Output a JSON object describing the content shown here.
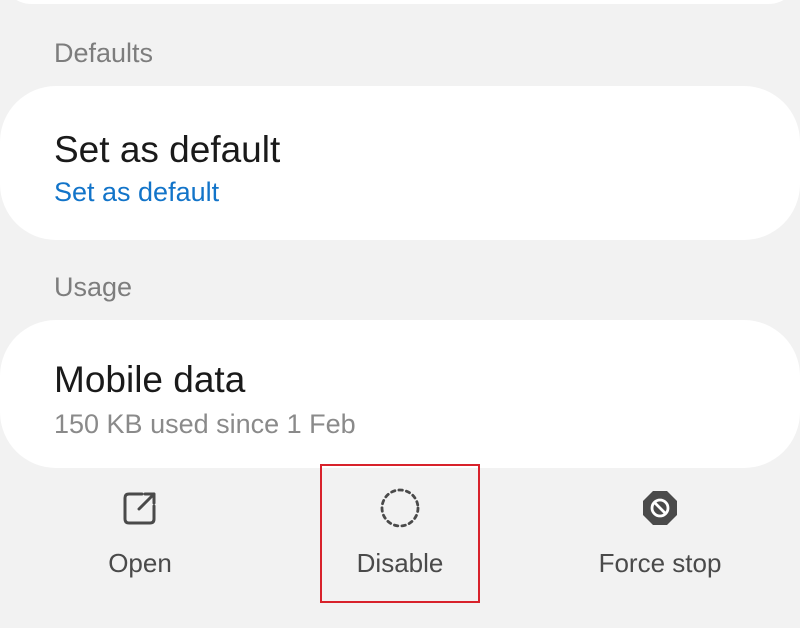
{
  "sections": {
    "defaults_header": "Defaults",
    "usage_header": "Usage"
  },
  "defaults_card": {
    "title": "Set as default",
    "subtitle": "Set as default"
  },
  "usage_card": {
    "title": "Mobile data",
    "subtitle": "150 KB used since 1 Feb"
  },
  "bottom_actions": {
    "open": {
      "label": "Open",
      "icon": "open-external-icon"
    },
    "disable": {
      "label": "Disable",
      "icon": "dotted-circle-icon"
    },
    "force_stop": {
      "label": "Force stop",
      "icon": "stop-octagon-icon"
    }
  },
  "colors": {
    "background": "#f2f2f2",
    "card": "#ffffff",
    "link_blue": "#1274c9",
    "highlight_red": "#d8222b"
  }
}
